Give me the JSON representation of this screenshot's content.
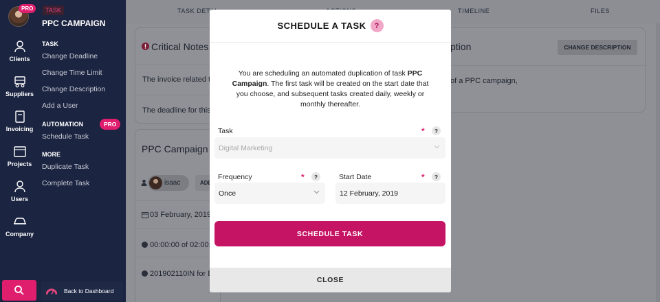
{
  "rail": {
    "pro_badge": "PRO",
    "items": [
      {
        "label": "Clients"
      },
      {
        "label": "Suppliers"
      },
      {
        "label": "Invoicing"
      },
      {
        "label": "Projects"
      },
      {
        "label": "Users"
      },
      {
        "label": "Company"
      }
    ]
  },
  "menu": {
    "task_badge": "TASK",
    "title": "PPC CAMPAIGN",
    "task_section": "TASK",
    "task_links": [
      "Change Deadline",
      "Change Time Limit",
      "Change Description",
      "Add a User"
    ],
    "automation_section": "AUTOMATION",
    "automation_pro": "PRO",
    "automation_link": "Schedule Task",
    "more_section": "MORE",
    "more_links": [
      "Duplicate Task",
      "Complete Task"
    ],
    "back_label": "Back to Dashboard"
  },
  "main": {
    "tabs": [
      "TASK DETAI",
      "ACTIONS",
      "TIMELINE",
      "FILES"
    ],
    "critical_notes_title": "Critical Notes",
    "note_1": "The invoice related to",
    "note_2": "The deadline for this",
    "description_title": "ption",
    "change_description_btn": "CHANGE DESCRIPTION",
    "description_text": "of a PPC campaign,",
    "project_title": "PPC Campaign",
    "user_name": "isaac",
    "add_btn": "ADD",
    "date_line": "03 February, 2019",
    "time_line": "00:00:00 of 02:00:",
    "invoice_line": "201902110IN for B"
  },
  "modal": {
    "title": "SCHEDULE A TASK",
    "help": "?",
    "intro_before": "You are scheduling an automated duplication of task ",
    "intro_task": "PPC Campaign",
    "intro_after": ". The first task will be created on the start date that you choose, and subsequent tasks created daily, weekly or monthly thereafter.",
    "task_label": "Task",
    "task_value": "Digital Marketing",
    "frequency_label": "Frequency",
    "frequency_value": "Once",
    "start_date_label": "Start Date",
    "start_date_value": "12 February, 2019",
    "required_mark": "*",
    "help_mark": "?",
    "schedule_btn": "SCHEDULE TASK",
    "close_btn": "CLOSE"
  },
  "colors": {
    "accent": "#e01e6e",
    "primary_button": "#c51463",
    "sidebar": "#1b2440"
  }
}
